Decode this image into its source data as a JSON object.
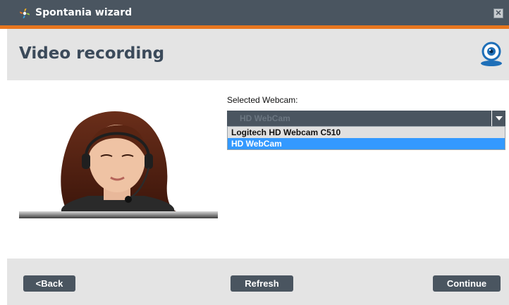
{
  "window": {
    "title": "Spontania wizard",
    "close_symbol": "✕"
  },
  "header": {
    "title": "Video recording"
  },
  "webcam": {
    "label": "Selected Webcam:",
    "selected": "HD WebCam",
    "options": [
      "Logitech HD Webcam C510",
      "HD WebCam"
    ],
    "highlighted_index": 1
  },
  "footer": {
    "back_label": "<Back",
    "refresh_label": "Refresh",
    "continue_label": "Continue"
  },
  "colors": {
    "titlebar": "#4a5560",
    "accent": "#e8761e",
    "panel": "#e4e4e4",
    "button": "#4a5560",
    "title_text": "#3b4a5a",
    "highlight": "#3399ff"
  },
  "icons": {
    "app": "spontania-logo-icon",
    "close": "close-icon",
    "header": "webcam-icon",
    "dropdown": "chevron-down-icon"
  }
}
